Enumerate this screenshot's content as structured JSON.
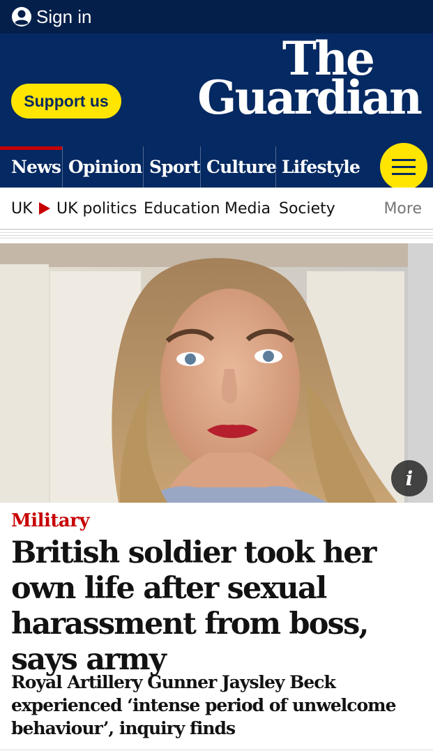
{
  "header": {
    "signin_label": "Sign in",
    "support_label": "Support us",
    "logo_line1": "The",
    "logo_line2": "Guardian"
  },
  "pillars": [
    {
      "label": "News",
      "active": true
    },
    {
      "label": "Opinion"
    },
    {
      "label": "Sport"
    },
    {
      "label": "Culture"
    },
    {
      "label": "Lifestyle"
    }
  ],
  "subnav": {
    "items": [
      "UK",
      "UK politics",
      "Education",
      "Media",
      "Society"
    ],
    "more_label": "More"
  },
  "article": {
    "image_info_label": "i",
    "kicker": "Military",
    "headline": "British soldier took her own life after sexual harassment from boss, says army",
    "standfirst": "Royal Artillery Gunner Jaysley Beck experienced ‘intense period of unwelcome behaviour’, inquiry finds"
  },
  "colors": {
    "brand_dark": "#052962",
    "topbar": "#041f4a",
    "accent_yellow": "#ffe500",
    "news_red": "#c70000"
  },
  "icons": [
    "user-icon",
    "menu-icon",
    "info-icon",
    "triangle-right-icon"
  ]
}
